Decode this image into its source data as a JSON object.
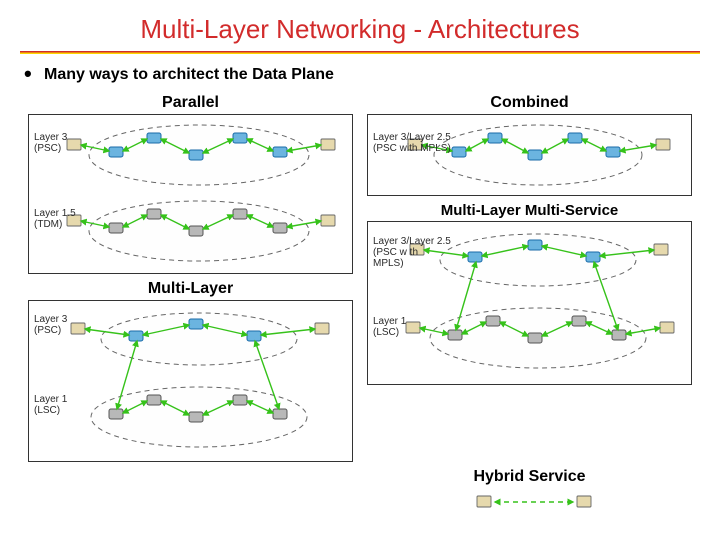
{
  "title": "Multi-Layer Networking - Architectures",
  "bullet": "Many ways to architect the Data Plane",
  "panels": {
    "parallel": {
      "title": "Parallel",
      "rows": [
        {
          "label": "Layer 3\n(PSC)",
          "nodeColor": "blue",
          "count": 5
        },
        {
          "label": "Layer 1.5\n(TDM)",
          "nodeColor": "gray",
          "count": 5
        }
      ]
    },
    "combined": {
      "title": "Combined",
      "rows": [
        {
          "label": "Layer 3/Layer 2.5\n(PSC with MPLS)",
          "nodeColor": "blue",
          "count": 5
        }
      ]
    },
    "multilayer": {
      "title": "Multi-Layer",
      "rows": [
        {
          "label": "Layer 3\n(PSC)",
          "nodeColor": "blue",
          "count": 3
        },
        {
          "label": "Layer 1\n(LSC)",
          "nodeColor": "gray",
          "count": 5
        }
      ]
    },
    "mlms": {
      "title": "Multi-Layer Multi-Service",
      "rows": [
        {
          "label": "Layer 3/Layer 2.5\n(PSC w th MPLS)",
          "nodeColor": "blue",
          "count": 3
        },
        {
          "label": "Layer 1\n(LSC)",
          "nodeColor": "gray",
          "count": 5
        }
      ]
    },
    "hybrid": {
      "title": "Hybrid Service"
    }
  }
}
